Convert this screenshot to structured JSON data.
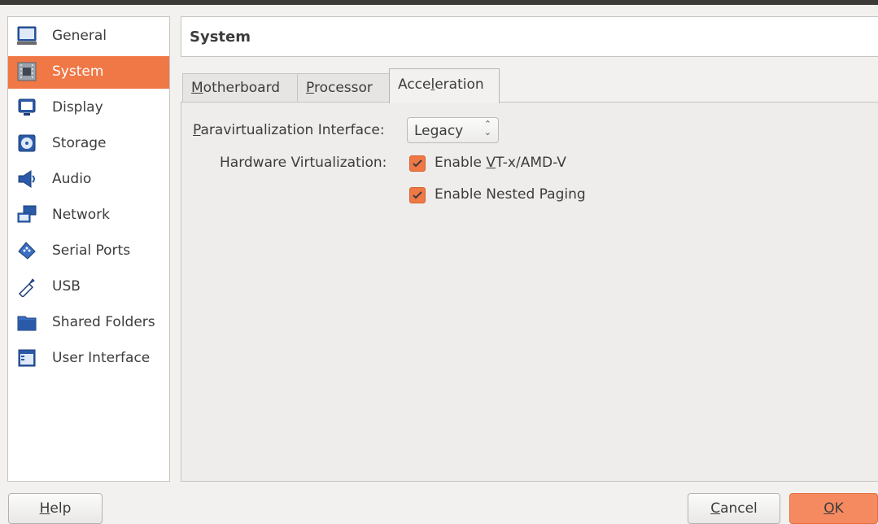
{
  "sidebar": {
    "items": [
      {
        "label": "General",
        "icon": "monitor-icon"
      },
      {
        "label": "System",
        "icon": "chip-icon",
        "active": true
      },
      {
        "label": "Display",
        "icon": "display-icon"
      },
      {
        "label": "Storage",
        "icon": "disk-icon"
      },
      {
        "label": "Audio",
        "icon": "speaker-icon"
      },
      {
        "label": "Network",
        "icon": "network-icon"
      },
      {
        "label": "Serial Ports",
        "icon": "serial-port-icon"
      },
      {
        "label": "USB",
        "icon": "usb-icon"
      },
      {
        "label": "Shared Folders",
        "icon": "folder-icon"
      },
      {
        "label": "User Interface",
        "icon": "window-icon"
      }
    ]
  },
  "header": {
    "title": "System"
  },
  "tabs": [
    {
      "label": "Motherboard",
      "mnemonic": "M",
      "rest": "otherboard"
    },
    {
      "label": "Processor",
      "mnemonic": "P",
      "rest": "rocessor"
    },
    {
      "label": "Acceleration",
      "pre": "Acce",
      "mnemonic": "l",
      "rest": "eration",
      "active": true
    }
  ],
  "acceleration": {
    "paravirt_label_mn": "P",
    "paravirt_label_rest": "aravirtualization Interface:",
    "paravirt_value": "Legacy",
    "hw_virt_label": "Hardware Virtualization:",
    "vtx_pre": "Enable ",
    "vtx_mn": "V",
    "vtx_rest": "T-x/AMD-V",
    "vtx_checked": true,
    "nested_pre": "Enable Nested Pa",
    "nested_mn": "g",
    "nested_rest": "ing",
    "nested_checked": true
  },
  "buttons": {
    "help_mn": "H",
    "help_rest": "elp",
    "cancel_mn": "C",
    "cancel_rest": "ancel",
    "ok_label": "OK",
    "ok_mn": "O",
    "ok_rest": "K"
  },
  "colors": {
    "accent": "#f07746",
    "window_bg": "#f2f1f0",
    "title_bar": "#3c3b37"
  }
}
